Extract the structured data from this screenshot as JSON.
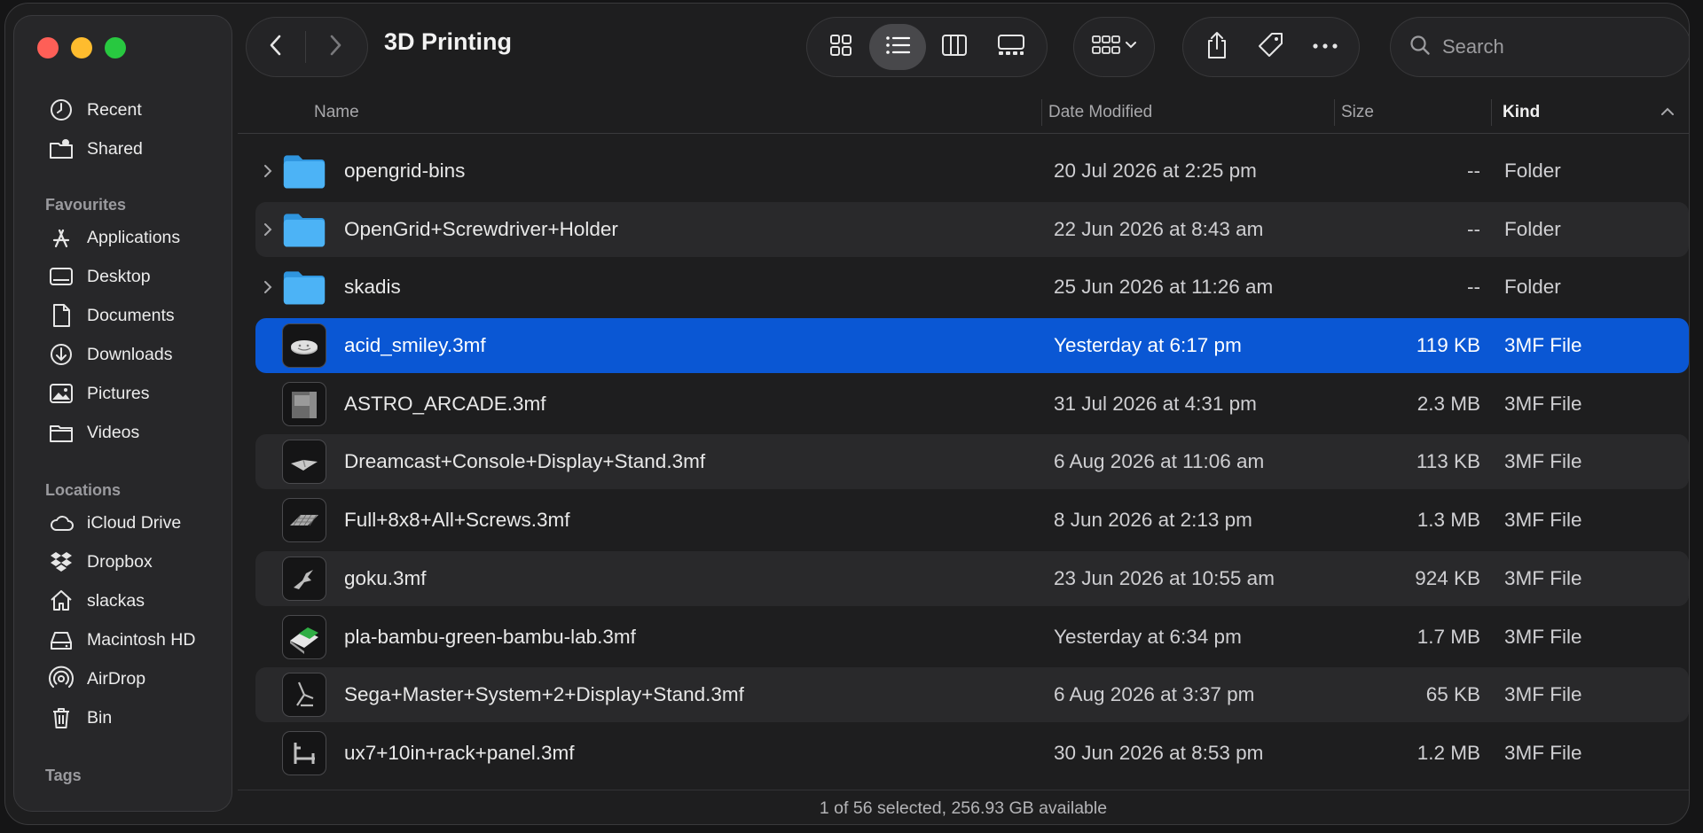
{
  "window": {
    "title": "3D Printing"
  },
  "sidebar": {
    "top_items": [
      {
        "label": "Recent",
        "icon": "clock-icon"
      },
      {
        "label": "Shared",
        "icon": "shared-folder-icon"
      }
    ],
    "favourites_heading": "Favourites",
    "favourites": [
      {
        "label": "Applications",
        "icon": "applications-icon"
      },
      {
        "label": "Desktop",
        "icon": "desktop-icon"
      },
      {
        "label": "Documents",
        "icon": "document-icon"
      },
      {
        "label": "Downloads",
        "icon": "download-icon"
      },
      {
        "label": "Pictures",
        "icon": "pictures-icon"
      },
      {
        "label": "Videos",
        "icon": "folder-icon"
      }
    ],
    "locations_heading": "Locations",
    "locations": [
      {
        "label": "iCloud Drive",
        "icon": "cloud-icon"
      },
      {
        "label": "Dropbox",
        "icon": "dropbox-icon"
      },
      {
        "label": "slackas",
        "icon": "home-icon"
      },
      {
        "label": "Macintosh HD",
        "icon": "drive-icon"
      },
      {
        "label": "AirDrop",
        "icon": "airdrop-icon"
      },
      {
        "label": "Bin",
        "icon": "trash-icon"
      }
    ],
    "tags_heading": "Tags"
  },
  "search": {
    "placeholder": "Search"
  },
  "columns": {
    "name": "Name",
    "date_modified": "Date Modified",
    "size": "Size",
    "kind": "Kind"
  },
  "files": [
    {
      "name": "opengrid-bins",
      "date": "20 Jul 2026 at 2:25 pm",
      "size": "--",
      "kind": "Folder",
      "type": "folder"
    },
    {
      "name": "OpenGrid+Screwdriver+Holder",
      "date": "22 Jun 2026 at 8:43 am",
      "size": "--",
      "kind": "Folder",
      "type": "folder"
    },
    {
      "name": "skadis",
      "date": "25 Jun 2026 at 11:26 am",
      "size": "--",
      "kind": "Folder",
      "type": "folder"
    },
    {
      "name": "acid_smiley.3mf",
      "date": "Yesterday at 6:17 pm",
      "size": "119 KB",
      "kind": "3MF File",
      "type": "file",
      "selected": true
    },
    {
      "name": "ASTRO_ARCADE.3mf",
      "date": "31 Jul 2026 at 4:31 pm",
      "size": "2.3 MB",
      "kind": "3MF File",
      "type": "file"
    },
    {
      "name": "Dreamcast+Console+Display+Stand.3mf",
      "date": "6 Aug 2026 at 11:06 am",
      "size": "113 KB",
      "kind": "3MF File",
      "type": "file"
    },
    {
      "name": "Full+8x8+All+Screws.3mf",
      "date": "8 Jun 2026 at 2:13 pm",
      "size": "1.3 MB",
      "kind": "3MF File",
      "type": "file"
    },
    {
      "name": "goku.3mf",
      "date": "23 Jun 2026 at 10:55 am",
      "size": "924 KB",
      "kind": "3MF File",
      "type": "file"
    },
    {
      "name": "pla-bambu-green-bambu-lab.3mf",
      "date": "Yesterday at 6:34 pm",
      "size": "1.7 MB",
      "kind": "3MF File",
      "type": "file"
    },
    {
      "name": "Sega+Master+System+2+Display+Stand.3mf",
      "date": "6 Aug 2026 at 3:37 pm",
      "size": "65 KB",
      "kind": "3MF File",
      "type": "file"
    },
    {
      "name": "ux7+10in+rack+panel.3mf",
      "date": "30 Jun 2026 at 8:53 pm",
      "size": "1.2 MB",
      "kind": "3MF File",
      "type": "file"
    }
  ],
  "status": {
    "text": "1 of 56 selected, 256.93 GB available"
  },
  "colors": {
    "selection": "#0a57d4",
    "folder": "#3fa9f5",
    "traffic_red": "#fe5f57",
    "traffic_yellow": "#febc2e",
    "traffic_green": "#28c840"
  }
}
